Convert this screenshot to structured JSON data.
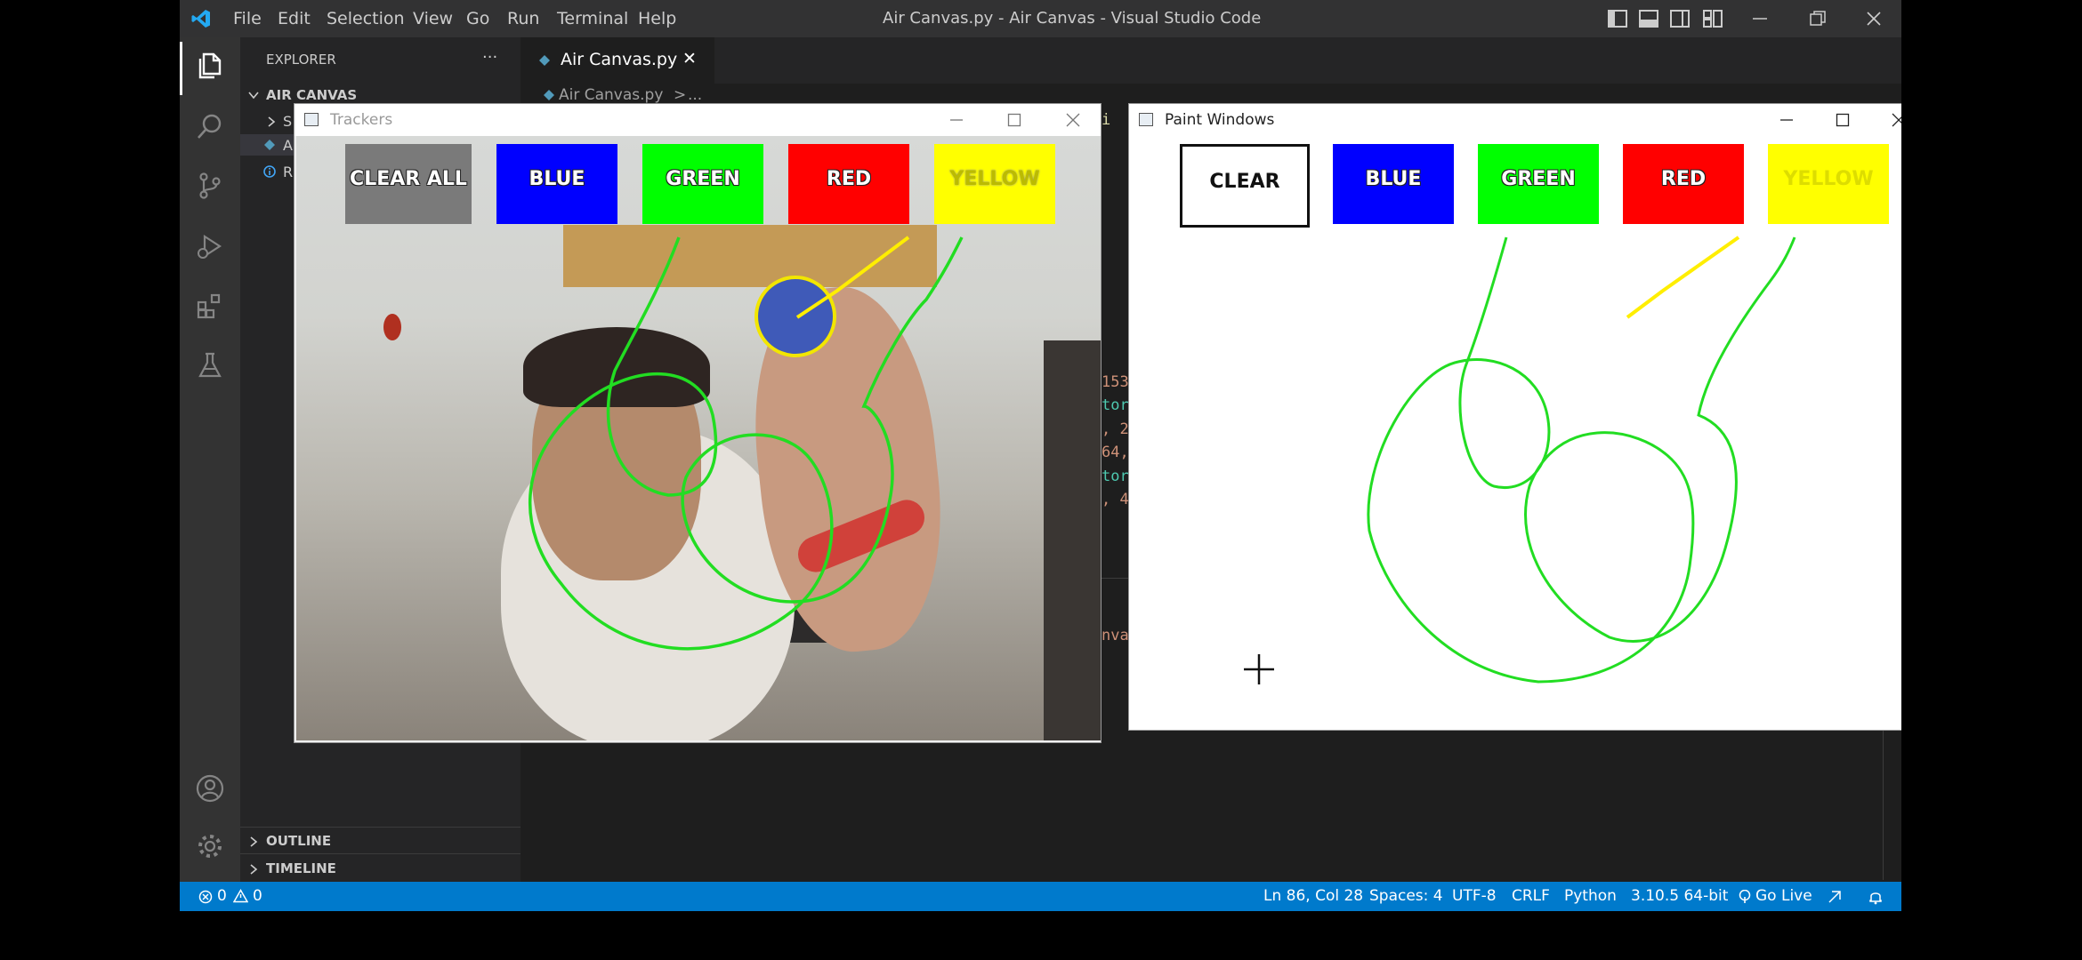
{
  "window_title": "Air Canvas.py - Air Canvas - Visual Studio Code",
  "menu": [
    "File",
    "Edit",
    "Selection",
    "View",
    "Go",
    "Run",
    "Terminal",
    "Help"
  ],
  "sidebar": {
    "header": "EXPLORER",
    "more": "···",
    "folder": "AIR CANVAS",
    "items": [
      "S",
      "A",
      "R"
    ],
    "outline": "OUTLINE",
    "timeline": "TIMELINE"
  },
  "tab": {
    "label": "Air Canvas.py",
    "close": "✕"
  },
  "breadcrumb": {
    "file": "Air Canvas.py",
    "sep": ">",
    "rest": "..."
  },
  "code_fragments": [
    "153",
    "tor",
    ", 2",
    "64,",
    "tor",
    ", 4",
    "nva",
    "i"
  ],
  "trackers_window": {
    "title": "Trackers",
    "buttons": [
      {
        "label": "CLEAR ALL",
        "color": "#7a7a7a"
      },
      {
        "label": "BLUE",
        "color": "#0000ff"
      },
      {
        "label": "GREEN",
        "color": "#00ff00"
      },
      {
        "label": "RED",
        "color": "#ff0000"
      },
      {
        "label": "YELLOW",
        "color": "#ffff00"
      }
    ]
  },
  "paint_window": {
    "title": "Paint Windows",
    "buttons": [
      {
        "label": "CLEAR",
        "color": "#ffffff"
      },
      {
        "label": "BLUE",
        "color": "#0000ff"
      },
      {
        "label": "GREEN",
        "color": "#00ff00"
      },
      {
        "label": "RED",
        "color": "#ff0000"
      },
      {
        "label": "YELLOW",
        "color": "#ffff00"
      }
    ]
  },
  "stroke_colors": {
    "green": "#22dd22",
    "yellow": "#ffee00"
  },
  "status": {
    "errors": "0",
    "warnings": "0",
    "position": "Ln 86, Col 28",
    "spaces": "Spaces: 4",
    "encoding": "UTF-8",
    "eol": "CRLF",
    "language": "Python",
    "interpreter": "3.10.5 64-bit",
    "golive": "Go Live"
  },
  "colors": {
    "statusbar": "#007acc",
    "accent": "#0078d4"
  }
}
